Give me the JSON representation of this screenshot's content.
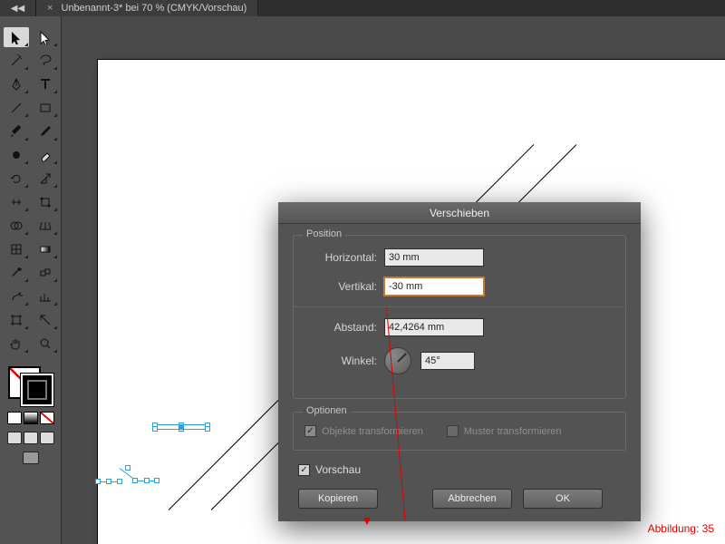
{
  "tabbar": {
    "expand_glyph": "◀◀",
    "doc_title": "Unbenannt-3* bei 70 % (CMYK/Vorschau)"
  },
  "dialog": {
    "title": "Verschieben",
    "position_legend": "Position",
    "horizontal_label": "Horizontal:",
    "horizontal_value": "30 mm",
    "vertical_label": "Vertikal:",
    "vertical_value": "-30 mm",
    "distance_label": "Abstand:",
    "distance_value": "42,4264 mm",
    "angle_label": "Winkel:",
    "angle_value": "45°",
    "options_legend": "Optionen",
    "opt_objects": "Objekte transformieren",
    "opt_patterns": "Muster transformieren",
    "preview_label": "Vorschau",
    "btn_copy": "Kopieren",
    "btn_cancel": "Abbrechen",
    "btn_ok": "OK"
  },
  "caption": "Abbildung: 35",
  "colors": {
    "accent": "#29a0e0",
    "annotation": "#e00000"
  },
  "tools": [
    "selection",
    "direct-selection",
    "magic-wand",
    "lasso",
    "pen",
    "type",
    "line-segment",
    "rectangle",
    "paintbrush",
    "pencil",
    "blob-brush",
    "eraser",
    "rotate",
    "scale",
    "width",
    "free-transform",
    "shape-builder",
    "perspective-grid",
    "mesh",
    "gradient",
    "eyedropper",
    "blend",
    "symbol-sprayer",
    "column-graph",
    "artboard",
    "slice",
    "hand",
    "zoom"
  ]
}
